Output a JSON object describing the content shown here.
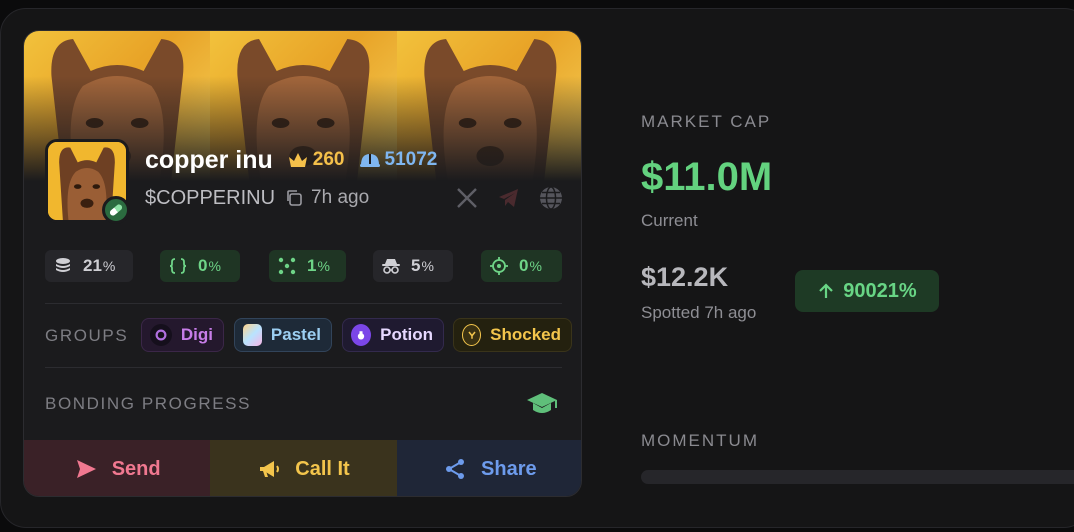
{
  "token": {
    "name": "copper inu",
    "crown_count": "260",
    "holder_count": "51072",
    "ticker": "$COPPERINU",
    "age": "7h ago"
  },
  "stats": [
    {
      "icon": "coin-stack-icon",
      "value": "21",
      "unit": "%",
      "tone": "neutral"
    },
    {
      "icon": "code-braces-icon",
      "value": "0",
      "unit": "%",
      "tone": "good"
    },
    {
      "icon": "dots-cluster-icon",
      "value": "1",
      "unit": "%",
      "tone": "good"
    },
    {
      "icon": "incognito-icon",
      "value": "5",
      "unit": "%",
      "tone": "neutral"
    },
    {
      "icon": "crosshair-icon",
      "value": "0",
      "unit": "%",
      "tone": "good"
    }
  ],
  "groups": {
    "label": "GROUPS",
    "items": [
      {
        "label": "Digi",
        "color": "#c77de8"
      },
      {
        "label": "Pastel",
        "color": "#9ccff2"
      },
      {
        "label": "Potion",
        "color": "#e6d8ff"
      },
      {
        "label": "Shocked",
        "color": "#f3c54c"
      }
    ]
  },
  "bonding": {
    "label": "BONDING PROGRESS"
  },
  "actions": {
    "send": "Send",
    "call_it": "Call It",
    "share": "Share"
  },
  "market": {
    "label": "MARKET CAP",
    "value": "$11.0M",
    "value_sub": "Current",
    "spotted_value": "$12.2K",
    "spotted_sub": "Spotted 7h ago",
    "gain": "90021%",
    "momentum_label": "MOMENTUM",
    "momentum_level": 0
  },
  "colors": {
    "accent_green": "#63d27f",
    "send": "#f07890",
    "call_it": "#f3c54c",
    "share": "#6d9bec"
  }
}
